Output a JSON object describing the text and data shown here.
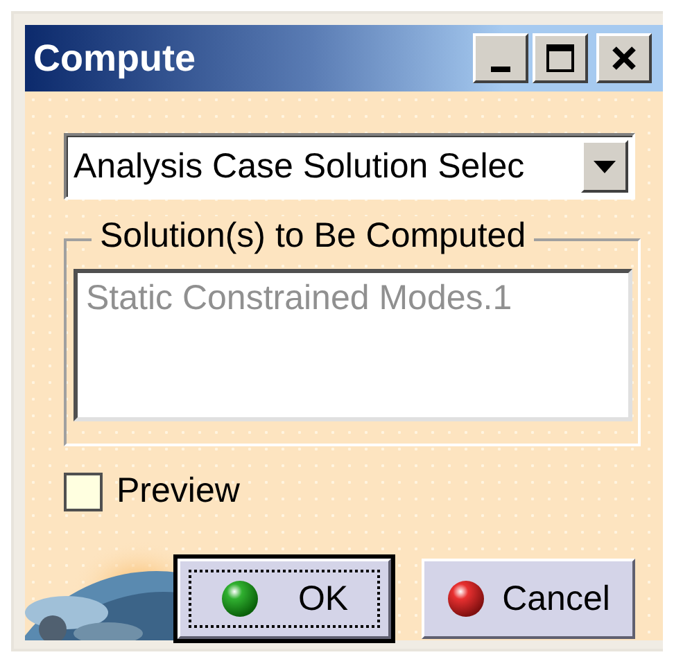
{
  "window": {
    "title": "Compute",
    "controls": [
      {
        "kind": "minimize"
      },
      {
        "kind": "maximize"
      },
      {
        "kind": "close"
      }
    ]
  },
  "dropdown": {
    "value": "Analysis Case Solution Selec"
  },
  "group": {
    "title": "Solution(s) to Be Computed",
    "items": [
      {
        "label": "Static Constrained Modes.1",
        "disabled": true
      }
    ]
  },
  "preview": {
    "label": "Preview",
    "checked": false
  },
  "buttons": [
    {
      "label": "OK",
      "kind": "ok",
      "focused": true
    },
    {
      "label": "Cancel",
      "kind": "cancel",
      "focused": false
    }
  ]
}
